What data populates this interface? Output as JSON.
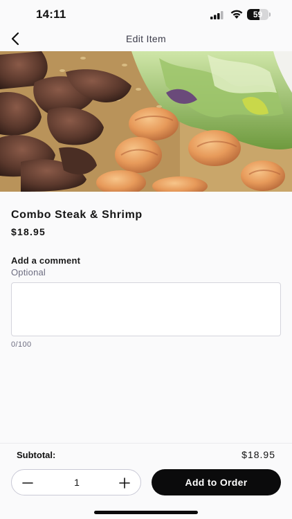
{
  "status_bar": {
    "time": "14:11",
    "battery_level": "59",
    "battery_fraction": 0.59,
    "icons": [
      "signal-icon",
      "wifi-icon",
      "battery-icon"
    ]
  },
  "nav": {
    "title": "Edit Item",
    "back_icon": "chevron-left-icon"
  },
  "item": {
    "image_description_icon": "food-photo",
    "name": "Combo Steak & Shrimp",
    "price": "$18.95"
  },
  "comment": {
    "label": "Add a comment",
    "sublabel": "Optional",
    "value": "",
    "placeholder": "",
    "count": "0/100"
  },
  "footer": {
    "subtotal_label": "Subtotal:",
    "subtotal_value": "$18.95",
    "quantity": "1",
    "minus_icon": "minus-icon",
    "plus_icon": "plus-icon",
    "add_button_label": "Add to Order"
  },
  "colors": {
    "background": "#fafafb",
    "primary_button": "#0b0b0c",
    "muted_text": "#6c6c80",
    "border": "#d4d4dc"
  }
}
